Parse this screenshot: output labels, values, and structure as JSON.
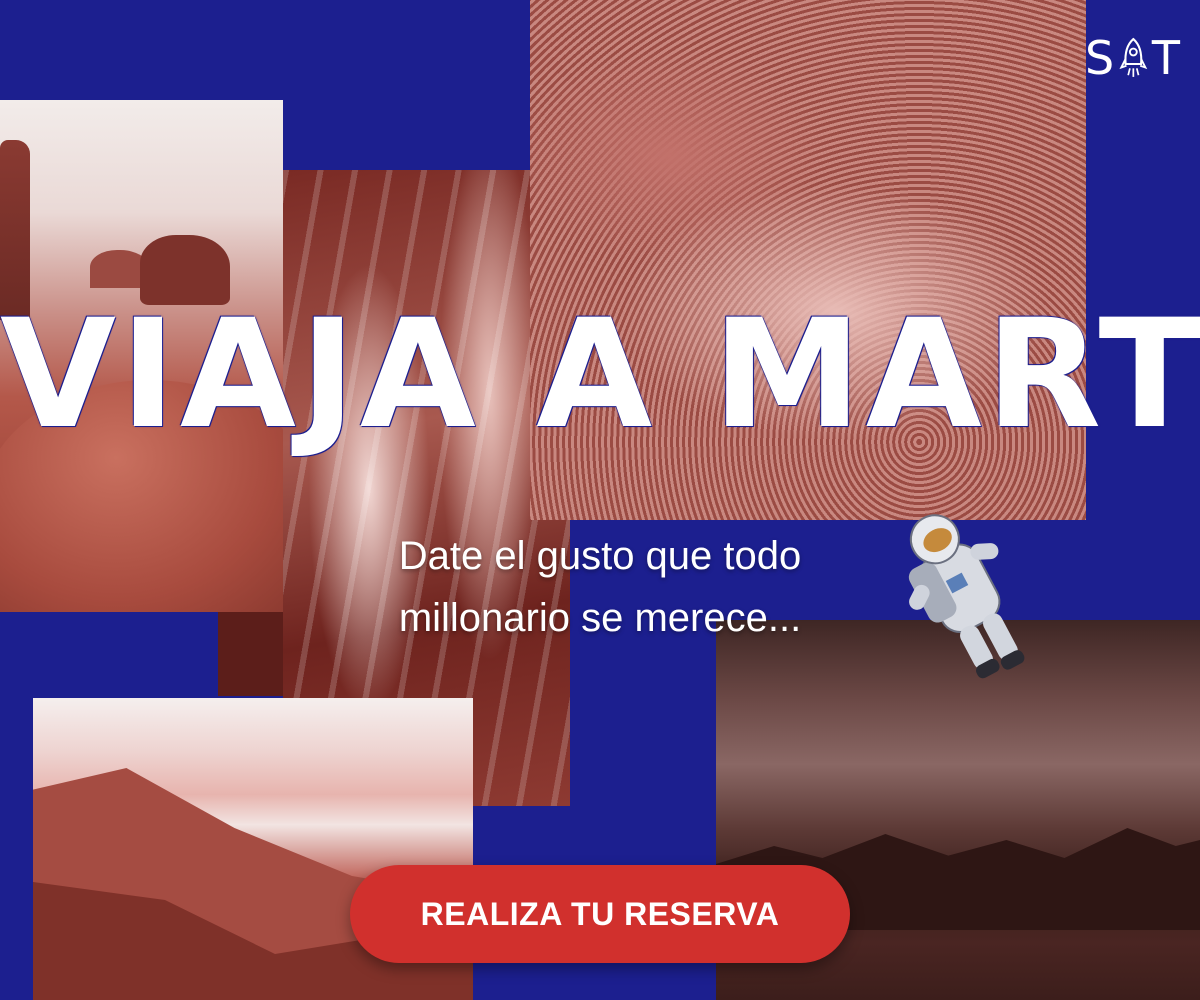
{
  "brand": {
    "logo_left": "S",
    "logo_icon": "rocket-icon",
    "logo_right": "T"
  },
  "hero": {
    "title": "VIAJA A MARTE",
    "subtitle_line1": "Date el gusto que todo",
    "subtitle_line2": "millonario se merece..."
  },
  "cta": {
    "label": "REALIZA TU RESERVA"
  },
  "colors": {
    "background": "#1c1f8f",
    "cta": "#d1302d",
    "text": "#ffffff"
  }
}
